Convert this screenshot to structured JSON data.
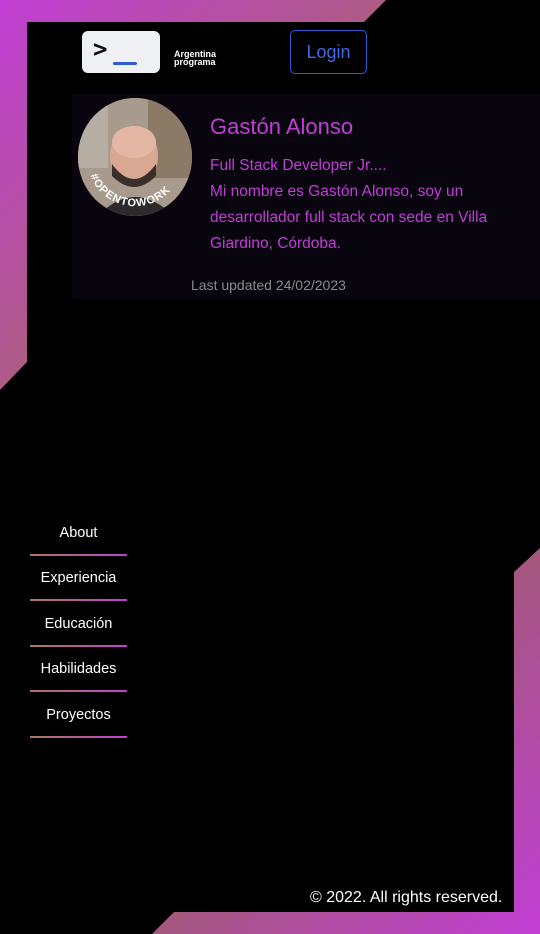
{
  "header": {
    "logo_icon": "terminal-prompt-icon",
    "brand_line1": "Argentina",
    "brand_line2": "programa",
    "login_label": "Login"
  },
  "profile": {
    "name": "Gastón Alonso",
    "bio_lines": [
      "Full Stack Developer Jr....",
      "Mi nombre es Gastón Alonso, soy un",
      "desarrollador full stack con sede en Villa",
      "Giardino, Córdoba."
    ],
    "avatar_badge": "#OPENTOWORK",
    "last_updated": "Last updated 24/02/2023"
  },
  "nav": {
    "items": [
      {
        "label": "About"
      },
      {
        "label": "Experiencia"
      },
      {
        "label": "Educación"
      },
      {
        "label": "Habilidades"
      },
      {
        "label": "Proyectos"
      }
    ]
  },
  "footer": {
    "copyright": "© 2022. All rights reserved."
  },
  "colors": {
    "accent_purple": "#c23ed8",
    "login_blue": "#2c5bd6",
    "frame_gold": "#a0704e"
  }
}
